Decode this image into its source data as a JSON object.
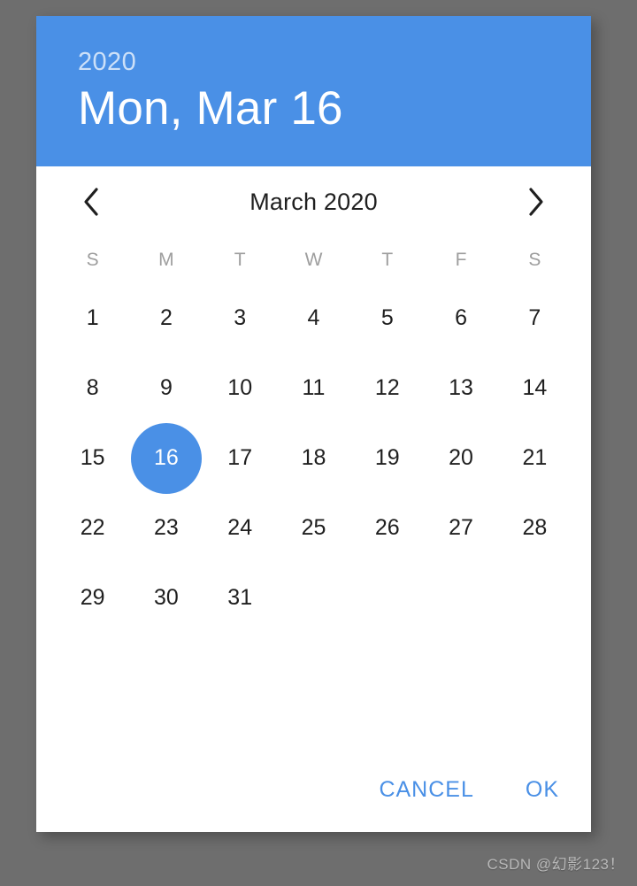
{
  "backdrop": {
    "color": "#6e6e6e"
  },
  "theme": {
    "accent": "#4a90e6",
    "surface": "#ffffff",
    "text_primary": "#1f1f1f",
    "text_muted": "#9e9e9e",
    "on_accent": "#ffffff"
  },
  "header": {
    "year": "2020",
    "date": "Mon, Mar 16"
  },
  "month_nav": {
    "prev_icon": "chevron-left-icon",
    "next_icon": "chevron-right-icon",
    "label": "March 2020"
  },
  "weekdays": [
    "S",
    "M",
    "T",
    "W",
    "T",
    "F",
    "S"
  ],
  "calendar": {
    "leading_blanks": 0,
    "days": [
      "1",
      "2",
      "3",
      "4",
      "5",
      "6",
      "7",
      "8",
      "9",
      "10",
      "11",
      "12",
      "13",
      "14",
      "15",
      "16",
      "17",
      "18",
      "19",
      "20",
      "21",
      "22",
      "23",
      "24",
      "25",
      "26",
      "27",
      "28",
      "29",
      "30",
      "31"
    ],
    "selected_day": "16"
  },
  "actions": {
    "cancel_label": "CANCEL",
    "ok_label": "OK"
  },
  "watermark": {
    "text": "CSDN @幻影123！"
  }
}
